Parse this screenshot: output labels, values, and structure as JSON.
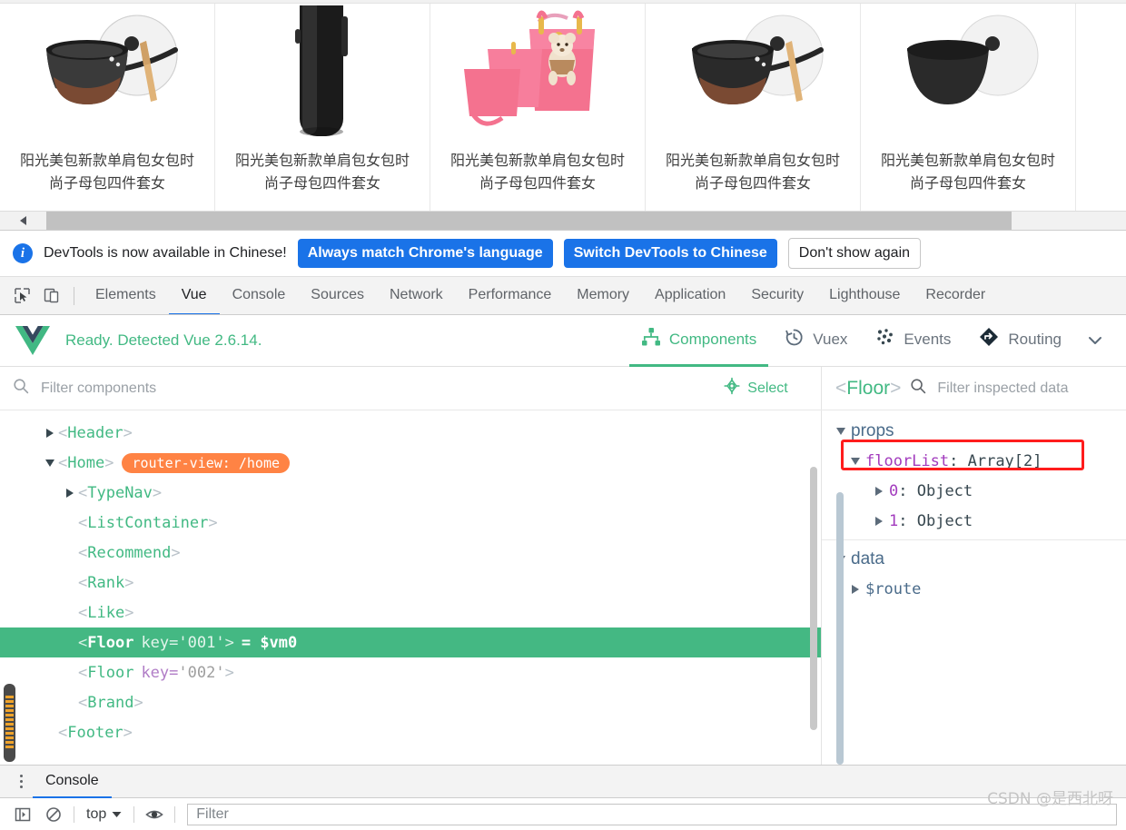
{
  "page": {
    "products": [
      {
        "title": "阳光美包新款单肩包女包时尚子母包四件套女",
        "image": "wok-pan"
      },
      {
        "title": "阳光美包新款单肩包女包时尚子母包四件套女",
        "image": "black-speaker"
      },
      {
        "title": "阳光美包新款单肩包女包时尚子母包四件套女",
        "image": "pink-handbag-set"
      },
      {
        "title": "阳光美包新款单肩包女包时尚子母包四件套女",
        "image": "wok-pan"
      },
      {
        "title": "阳光美包新款单肩包女包时尚子母包四件套女",
        "image": "wok-pan"
      }
    ]
  },
  "banner": {
    "icon": "info-icon",
    "message": "DevTools is now available in Chinese!",
    "primary_button": "Always match Chrome's language",
    "secondary_button": "Switch DevTools to Chinese",
    "dismiss_button": "Don't show again",
    "accent_color": "#1a73e8"
  },
  "devtools_tabs": {
    "active": "Vue",
    "items": [
      "Elements",
      "Vue",
      "Console",
      "Sources",
      "Network",
      "Performance",
      "Memory",
      "Application",
      "Security",
      "Lighthouse",
      "Recorder"
    ],
    "active_underline_color": "#1a73e8"
  },
  "vue_header": {
    "logo": "vue-logo",
    "status": "Ready. Detected Vue 2.6.14.",
    "accent_color": "#42b983",
    "nav": [
      {
        "label": "Components",
        "icon": "components-icon",
        "active": true
      },
      {
        "label": "Vuex",
        "icon": "history-clock-icon",
        "active": false
      },
      {
        "label": "Events",
        "icon": "events-dots-icon",
        "active": false
      },
      {
        "label": "Routing",
        "icon": "routing-diamond-icon",
        "active": false
      }
    ],
    "more_icon": "chevron-down-icon"
  },
  "filter_bar": {
    "components_placeholder": "Filter components",
    "search_icon": "search-icon",
    "select_label": "Select",
    "select_icon": "target-crosshair-icon",
    "inspected_title_open": "<",
    "inspected_title_name": "Floor",
    "inspected_title_close": ">",
    "inspected_placeholder": "Filter inspected data"
  },
  "component_tree": [
    {
      "indent": 1,
      "arrow": "right",
      "tag": "Header",
      "selected": false
    },
    {
      "indent": 1,
      "arrow": "down",
      "tag": "Home",
      "badge": "router-view: /home",
      "selected": false
    },
    {
      "indent": 2,
      "arrow": "right",
      "tag": "TypeNav",
      "selected": false
    },
    {
      "indent": 2,
      "arrow": "none",
      "tag": "ListContainer",
      "selected": false
    },
    {
      "indent": 2,
      "arrow": "none",
      "tag": "Recommend",
      "selected": false
    },
    {
      "indent": 2,
      "arrow": "none",
      "tag": "Rank",
      "selected": false
    },
    {
      "indent": 2,
      "arrow": "none",
      "tag": "Like",
      "selected": false
    },
    {
      "indent": 2,
      "arrow": "none",
      "tag": "Floor",
      "attr_key": "key",
      "attr_val": "'001'",
      "vm": "= $vm0",
      "selected": true
    },
    {
      "indent": 2,
      "arrow": "none",
      "tag": "Floor",
      "attr_key": "key",
      "attr_val": "'002'",
      "selected": false
    },
    {
      "indent": 2,
      "arrow": "none",
      "tag": "Brand",
      "selected": false
    },
    {
      "indent": 1,
      "arrow": "none",
      "tag": "Footer",
      "selected": false
    }
  ],
  "inspector": {
    "groups": [
      {
        "name": "props",
        "arrow": "down",
        "rows": [
          {
            "arrow": "down",
            "key": "floorList",
            "value": "Array[2]",
            "highlighted": true,
            "indent": 1
          },
          {
            "arrow": "right",
            "key": "0",
            "value": "Object",
            "indent": 2
          },
          {
            "arrow": "right",
            "key": "1",
            "value": "Object",
            "indent": 2
          }
        ]
      },
      {
        "name": "data",
        "arrow": "down",
        "rows": [
          {
            "arrow": "right",
            "key": "$route",
            "value": "",
            "plain": true,
            "indent": 1
          }
        ]
      }
    ],
    "highlight_color": "#ff1d1d"
  },
  "drawer": {
    "menu_icon": "kebab-menu-icon",
    "tab_label": "Console",
    "toolbar": {
      "sidebar_icon": "console-sidebar-icon",
      "clear_icon": "clear-console-icon",
      "context_label": "top",
      "context_caret": "chevron-down-icon",
      "eye_icon": "live-expression-eye-icon",
      "filter_placeholder": "Filter"
    }
  },
  "watermark": "CSDN @是西北呀"
}
